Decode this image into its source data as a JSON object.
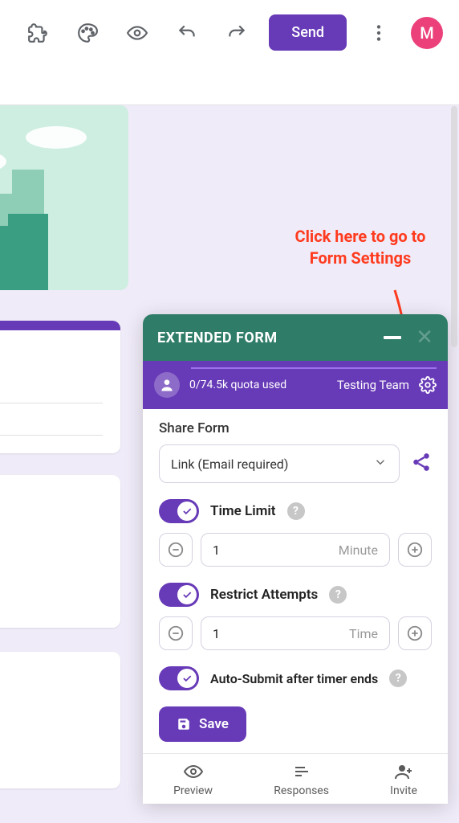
{
  "toolbar": {
    "send_label": "Send",
    "avatar_initial": "M"
  },
  "annotation": {
    "text": "Click here to go to Form Settings"
  },
  "panel": {
    "title": "EXTENDED FORM",
    "quota_text": "0/74.5k quota used",
    "team_name": "Testing Team",
    "share": {
      "section_label": "Share Form",
      "selected_option": "Link (Email required)"
    },
    "time_limit": {
      "label": "Time Limit",
      "value": "1",
      "unit": "Minute",
      "enabled": true
    },
    "restrict_attempts": {
      "label": "Restrict Attempts",
      "value": "1",
      "unit": "Time",
      "enabled": true
    },
    "auto_submit": {
      "label": "Auto-Submit after timer ends",
      "enabled": true
    },
    "save_label": "Save",
    "footer": {
      "preview": "Preview",
      "responses": "Responses",
      "invite": "Invite"
    }
  }
}
